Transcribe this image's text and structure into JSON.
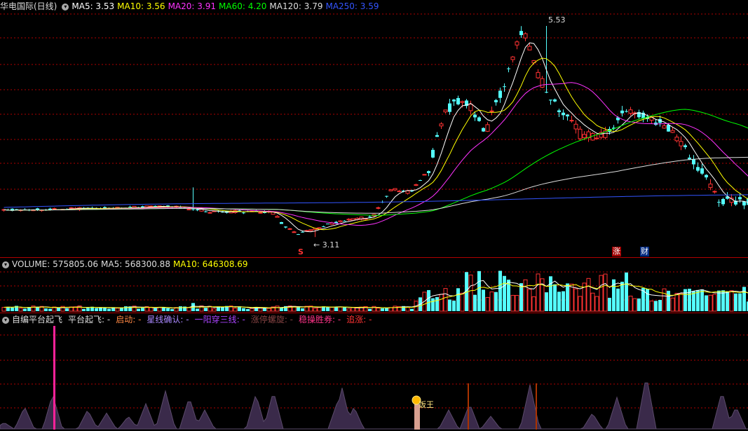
{
  "main": {
    "title": "华电国际(日线)",
    "mas": [
      {
        "label": "MA5: 3.53",
        "color": "#ffffff"
      },
      {
        "label": "MA10: 3.56",
        "color": "#ffff00"
      },
      {
        "label": "MA20: 3.91",
        "color": "#ff33ff"
      },
      {
        "label": "MA60: 4.20",
        "color": "#00ff00"
      },
      {
        "label": "MA120: 3.79",
        "color": "#dddddd"
      },
      {
        "label": "MA250: 3.59",
        "color": "#3355ff"
      }
    ],
    "high_label": "5.53",
    "low_label": "3.11",
    "markers": {
      "s": "S",
      "zhang": "涨",
      "cai": "财"
    }
  },
  "volume": {
    "label": "VOLUME: 575805.06",
    "ma5": "MA5: 568300.88",
    "ma10": "MA10: 646308.69"
  },
  "indicator": {
    "name": "自编平台起飞",
    "items": [
      {
        "label": "平台起飞: -",
        "color": "#dddddd"
      },
      {
        "label": "启动: -",
        "color": "#ff8844"
      },
      {
        "label": "星线确认: -",
        "color": "#aa88ff"
      },
      {
        "label": "一阳穿三线: -",
        "color": "#aa44ff"
      },
      {
        "label": "涨停螺旋: -",
        "color": "#884444"
      },
      {
        "label": "稳操胜券: -",
        "color": "#ff3388"
      },
      {
        "label": "追涨: -",
        "color": "#ff3333"
      }
    ],
    "badge": "饭王"
  },
  "colors": {
    "up": "#ff3232",
    "down": "#54ffff",
    "grid": "#b00000"
  }
}
